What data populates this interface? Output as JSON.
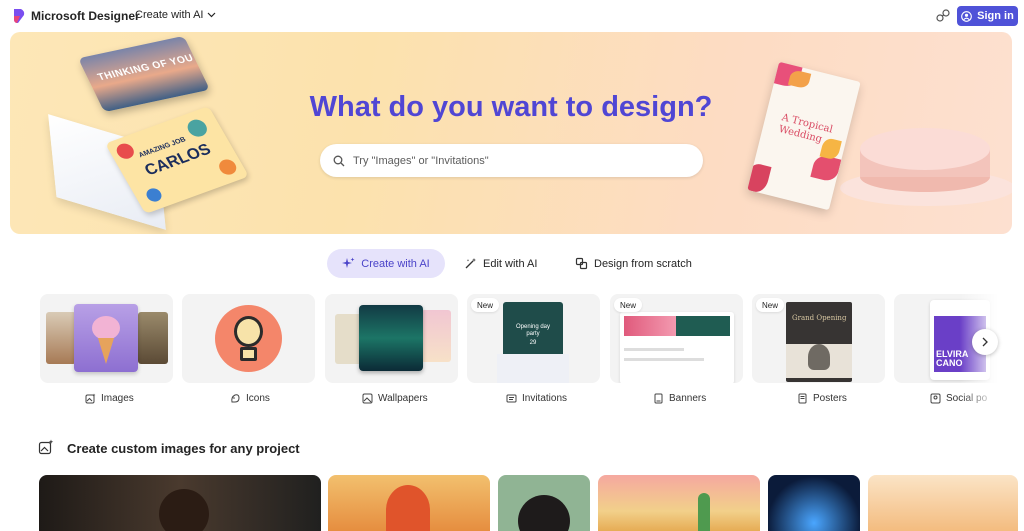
{
  "header": {
    "brand": "Microsoft Designer",
    "create_menu": "Create with AI",
    "sign_in": "Sign in",
    "icons": {
      "logo": "designer-logo-icon",
      "chevron": "chevron-down-icon",
      "share": "share-icon",
      "account": "account-icon"
    }
  },
  "hero": {
    "title": "What do you want to design?",
    "search_placeholder": "Try \"Images\" or \"Invitations\"",
    "card_thinking": "THINKING OF YOU",
    "card_amazing": "AMAZING JOB",
    "card_name": "CARLOS",
    "invite_title": "A Tropical Wedding"
  },
  "modes": [
    {
      "label": "Create with AI",
      "icon": "sparkle-icon",
      "active": true
    },
    {
      "label": "Edit with AI",
      "icon": "magic-wand-icon",
      "active": false
    },
    {
      "label": "Design from scratch",
      "icon": "shapes-icon",
      "active": false
    }
  ],
  "categories": [
    {
      "label": "Images",
      "icon": "image-sparkle-icon",
      "new": false
    },
    {
      "label": "Icons",
      "icon": "icon-sparkle-icon",
      "new": false
    },
    {
      "label": "Wallpapers",
      "icon": "wallpaper-icon",
      "new": false
    },
    {
      "label": "Invitations",
      "icon": "invitation-icon",
      "new": true
    },
    {
      "label": "Banners",
      "icon": "banner-icon",
      "new": true
    },
    {
      "label": "Posters",
      "icon": "poster-icon",
      "new": true
    },
    {
      "label": "Social po",
      "icon": "social-post-icon",
      "new": false
    }
  ],
  "new_badge": "New",
  "card_text": {
    "invitation_line1": "Opening day",
    "invitation_line2": "party",
    "invitation_date": "29",
    "poster_title": "Grand Opening",
    "social_name1": "ELVIRA",
    "social_name2": "CANO"
  },
  "section": {
    "title": "Create custom images for any project",
    "icon": "image-sparkle-icon"
  },
  "colors": {
    "accent": "#4f52d8",
    "hero_title": "#5046d4",
    "active_mode_bg": "#e6e3fb"
  }
}
